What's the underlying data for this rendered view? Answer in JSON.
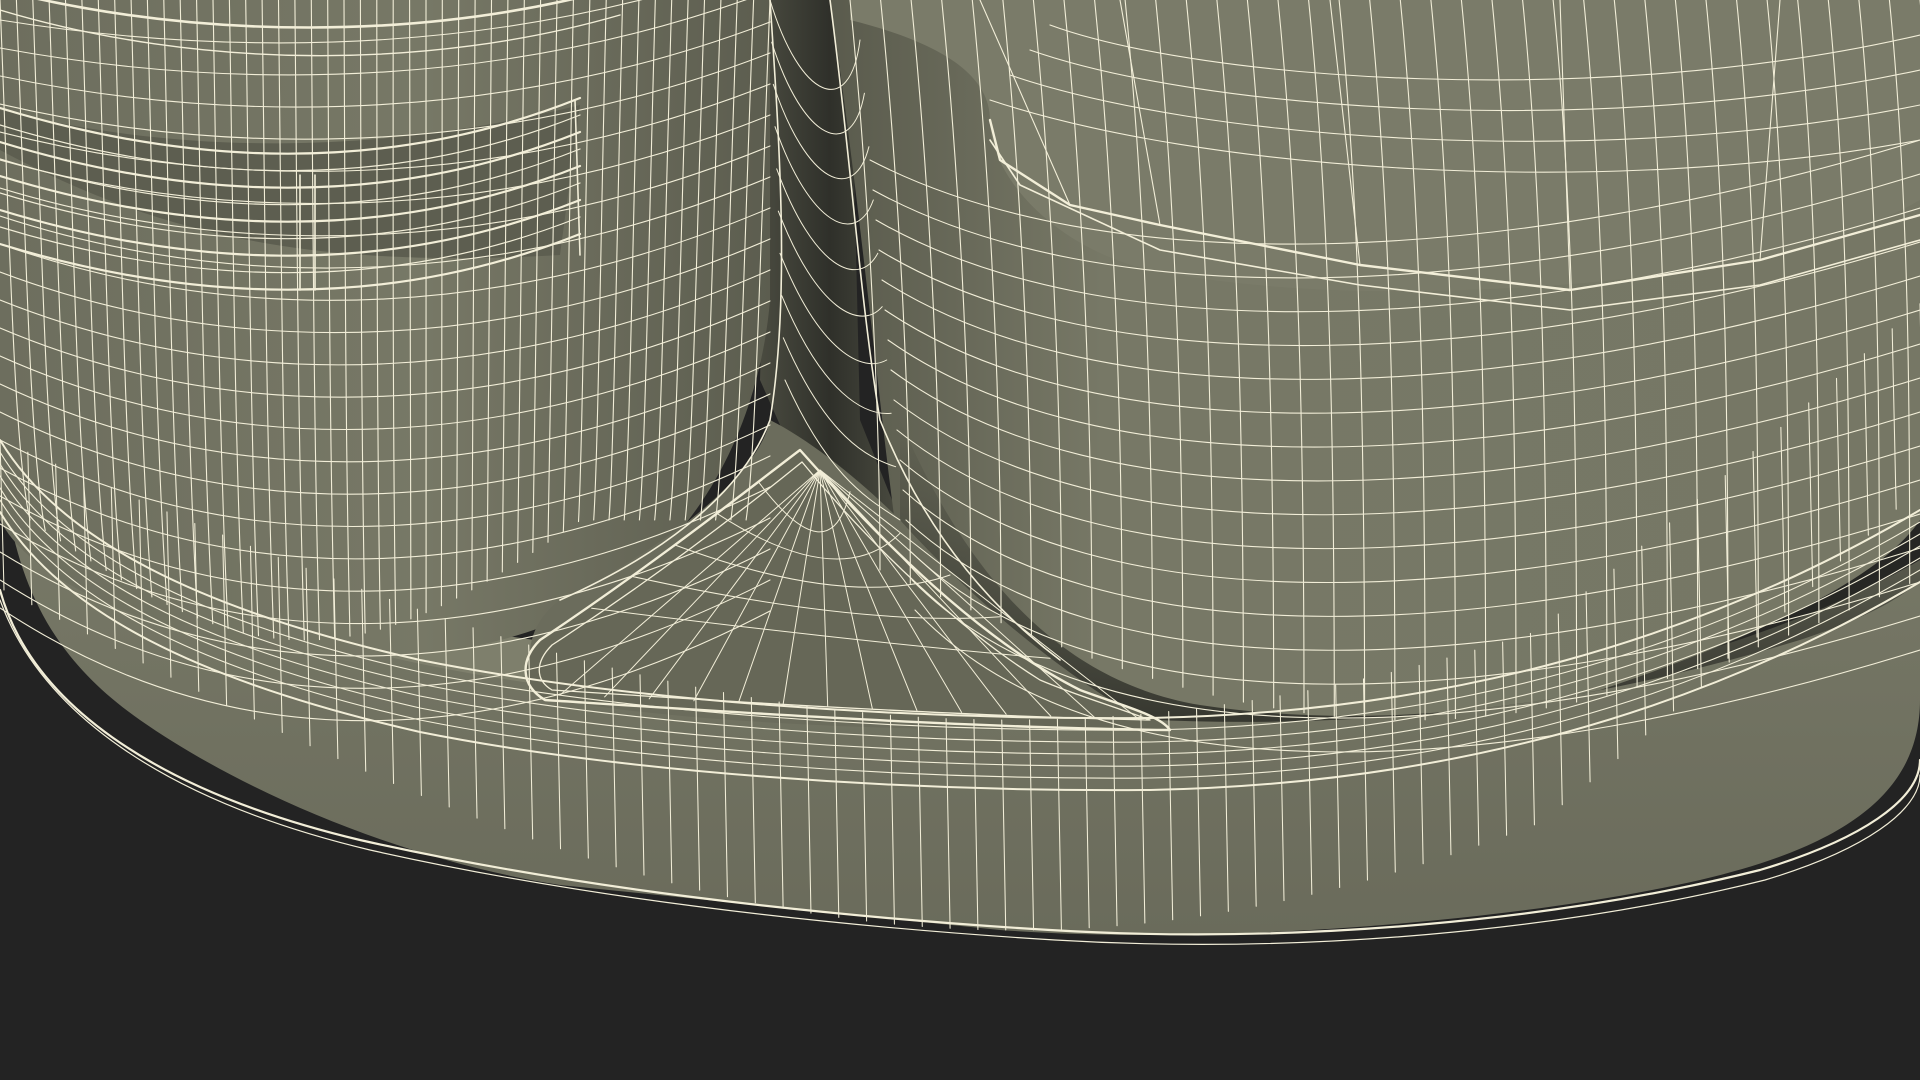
{
  "colors": {
    "background": "#232323",
    "surface": "#777866",
    "surface_shade": "#5e5f50",
    "surface_dark": "#3f4036",
    "wire": "#f2eed8"
  }
}
